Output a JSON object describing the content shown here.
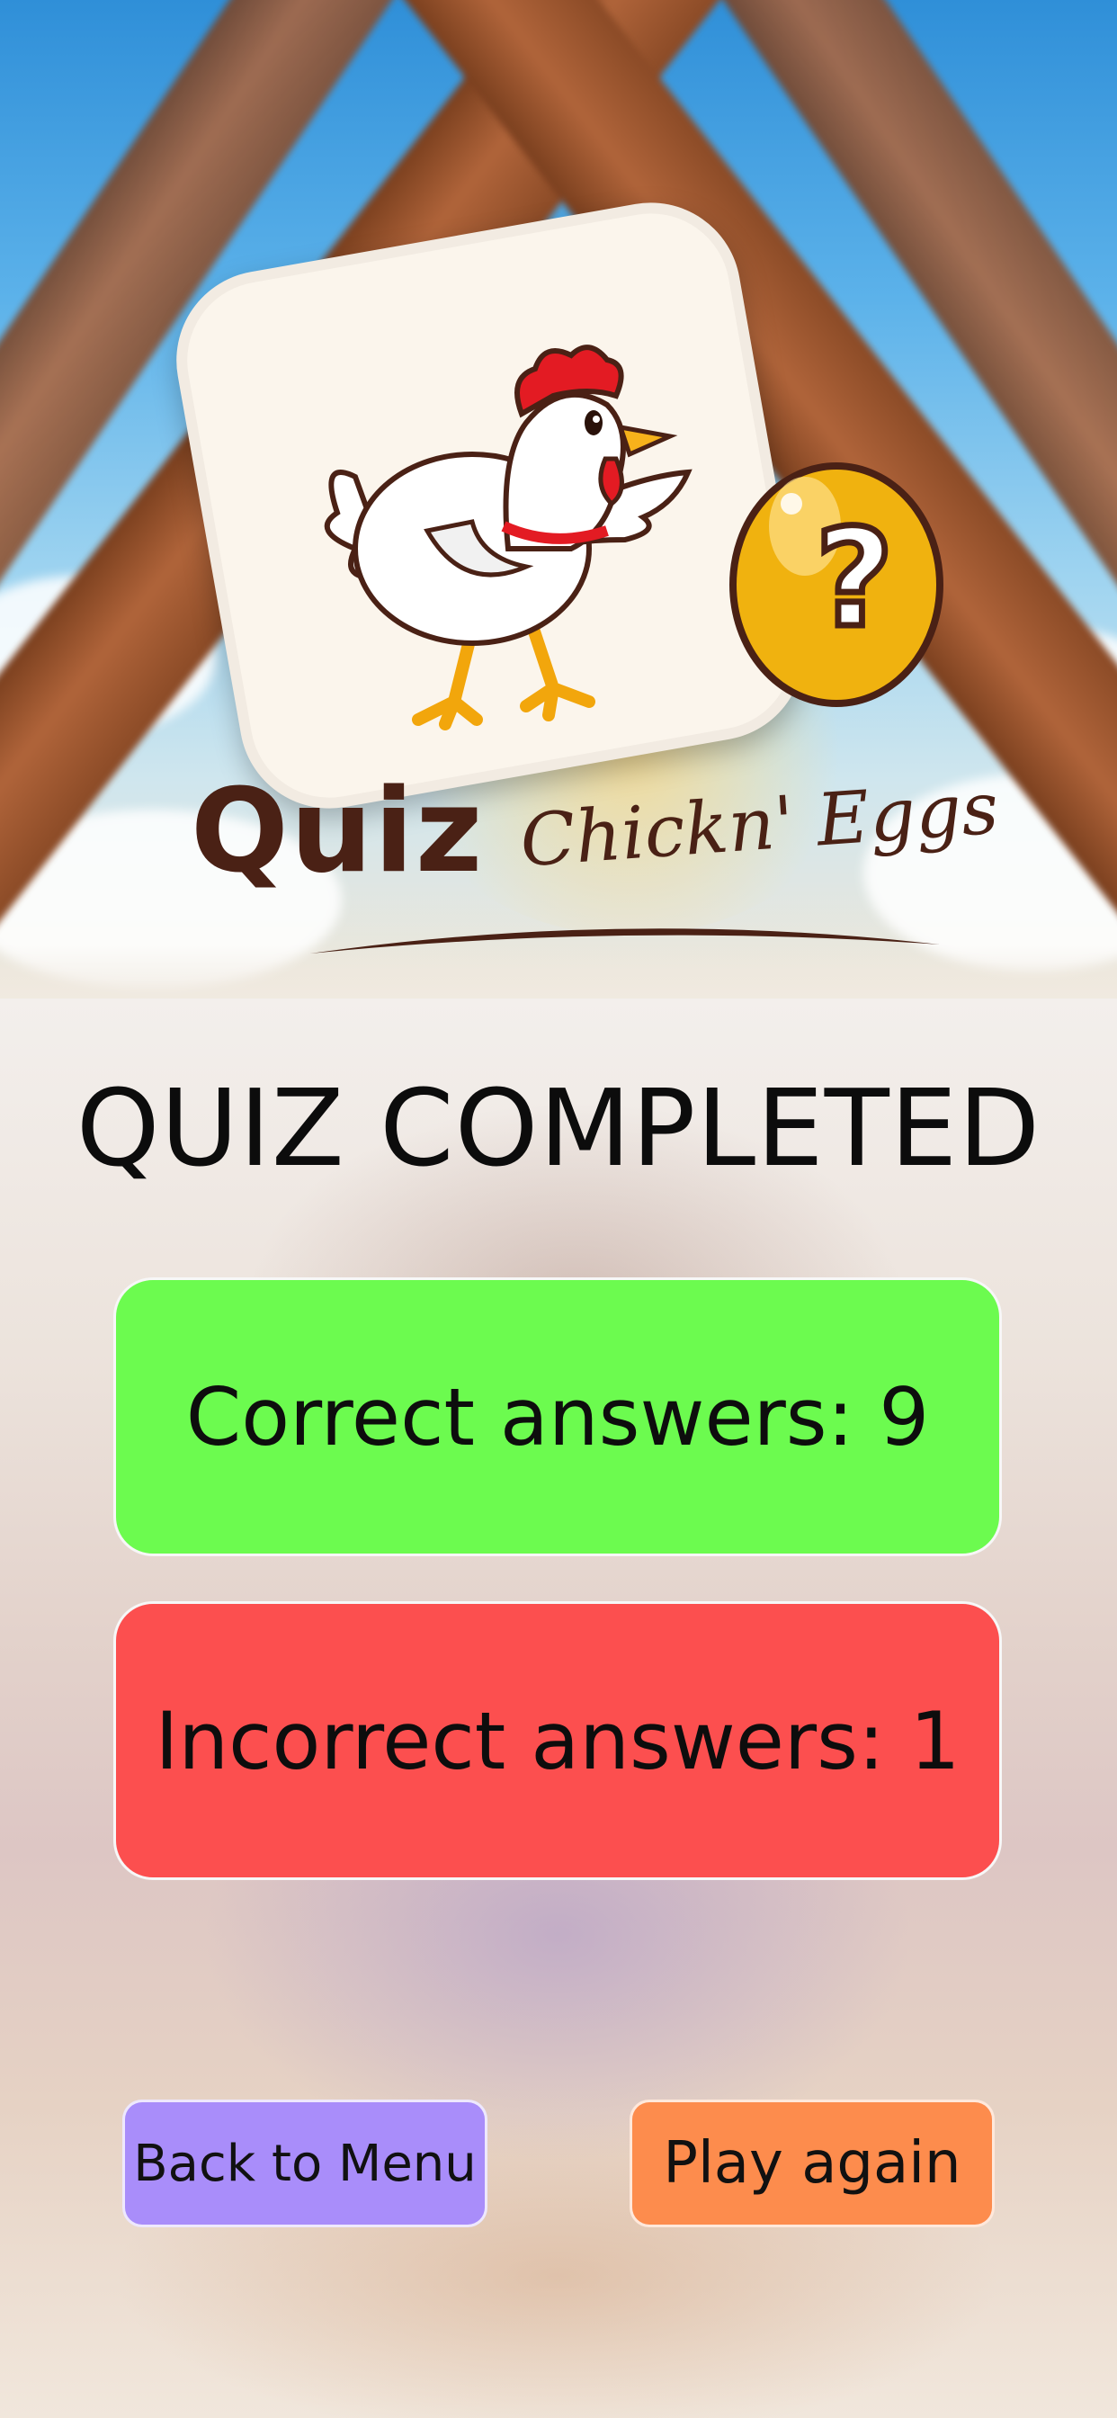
{
  "logo": {
    "word_main": "Quiz",
    "word_sub": "Chickn' Eggs",
    "egg_symbol": "?"
  },
  "page": {
    "title": "QUIZ COMPLETED"
  },
  "results": {
    "correct_label": "Correct answers: 9",
    "incorrect_label": "Incorrect answers: 1",
    "correct_count": 9,
    "incorrect_count": 1,
    "correct_color": "#6cfb4f",
    "incorrect_color": "#fc4f4f"
  },
  "buttons": {
    "back_to_menu": "Back to Menu",
    "play_again": "Play again",
    "back_color": "#a98dfa",
    "play_color": "#fd8c4d"
  },
  "icons": {
    "mascot": "chicken-icon",
    "egg": "golden-egg-question-icon"
  }
}
